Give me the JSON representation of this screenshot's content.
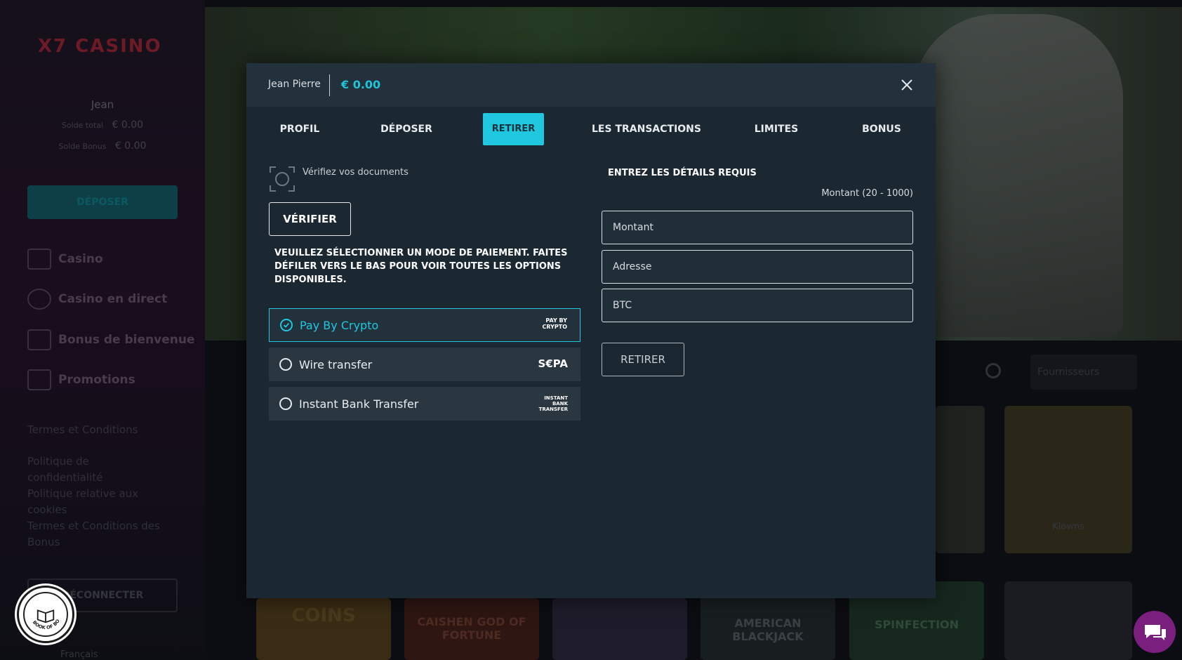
{
  "background": {
    "logo_text": "X7 CASINO",
    "user_name": "Jean",
    "total_balance_label": "Solde total",
    "total_balance": "€ 0.00",
    "bonus_balance_label": "Solde Bonus",
    "bonus_balance": "€ 0.00",
    "deposit_label": "DÉPOSER",
    "nav": [
      "Casino",
      "Casino en direct",
      "Bonus de bienvenue",
      "Promotions"
    ],
    "links": [
      "Termes et Conditions",
      "Politique de confidentialité",
      "Politique relative aux cookies",
      "Termes et Conditions des Bonus"
    ],
    "logout_label": "DÉCONNECTER",
    "language": "Français",
    "providers_label": "Fournisseurs",
    "games": [
      "Klowns",
      "AMERICAN BLACKJACK",
      "SPINFECTION",
      "COINS",
      "CAISHEN GOD OF FORTUNE"
    ]
  },
  "modal": {
    "user_name": "Jean Pierre",
    "balance": "€ 0.00",
    "tabs": [
      {
        "label": "PROFIL",
        "active": false
      },
      {
        "label": "DÉPOSER",
        "active": false
      },
      {
        "label": "RETIRER",
        "active": true
      },
      {
        "label": "LES TRANSACTIONS",
        "active": false
      },
      {
        "label": "LIMITES",
        "active": false
      },
      {
        "label": "BONUS",
        "active": false
      }
    ],
    "verify_text": "Vérifiez vos documents",
    "verify_button": "VÉRIFIER",
    "instructions": "VEUILLEZ SÉLECTIONNER UN MODE DE PAIEMENT. FAITES DÉFILER VERS LE BAS POUR VOIR TOUTES LES OPTIONS DISPONIBLES.",
    "payment_methods": [
      {
        "label": "Pay By Crypto",
        "logo": "PAY BY CRYPTO",
        "selected": true
      },
      {
        "label": "Wire transfer",
        "logo": "S€PA",
        "selected": false
      },
      {
        "label": "Instant Bank Transfer",
        "logo": "INSTANT BANK TRANSFER",
        "selected": false
      }
    ],
    "details_title": "ENTREZ LES DÉTAILS REQUIS",
    "amount_hint": "Montant (20 - 1000)",
    "fields": {
      "amount_placeholder": "Montant",
      "address_placeholder": "Adresse",
      "currency_value": "BTC"
    },
    "withdraw_button": "RETIRER"
  },
  "badge_text": "BOOK OF BONUS",
  "colors": {
    "accent": "#1fc8df",
    "modal_bg": "#1b2831",
    "modal_header": "#22313b",
    "chat": "#7a1f7e"
  }
}
